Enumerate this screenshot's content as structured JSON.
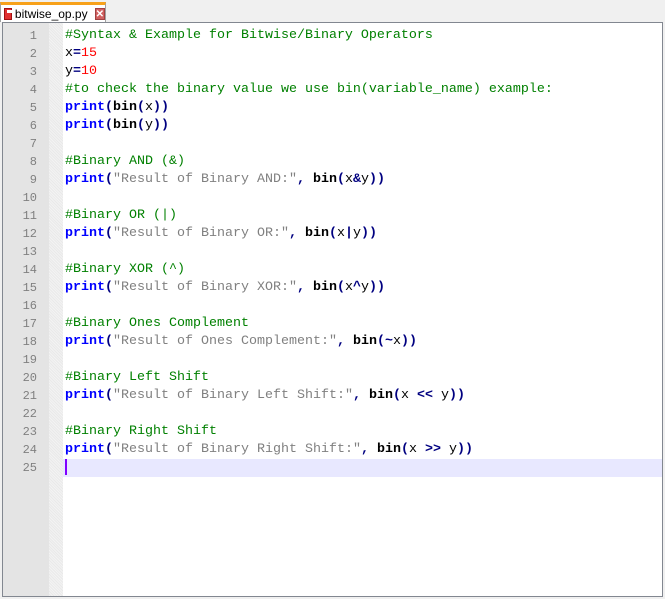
{
  "tab": {
    "filename": "bitwise_op.py",
    "close_symbol": "✕"
  },
  "current_line": 25,
  "lines": [
    [
      [
        "c",
        "#Syntax & Example for Bitwise/Binary Operators"
      ]
    ],
    [
      [
        "i",
        "x"
      ],
      [
        "o",
        "="
      ],
      [
        "n",
        "15"
      ]
    ],
    [
      [
        "i",
        "y"
      ],
      [
        "o",
        "="
      ],
      [
        "n",
        "10"
      ]
    ],
    [
      [
        "c",
        "#to check the binary value we use bin(variable_name) example:"
      ]
    ],
    [
      [
        "k",
        "print"
      ],
      [
        "o",
        "("
      ],
      [
        "b",
        "bin"
      ],
      [
        "o",
        "("
      ],
      [
        "i",
        "x"
      ],
      [
        "o",
        "))"
      ]
    ],
    [
      [
        "k",
        "print"
      ],
      [
        "o",
        "("
      ],
      [
        "b",
        "bin"
      ],
      [
        "o",
        "("
      ],
      [
        "i",
        "y"
      ],
      [
        "o",
        "))"
      ]
    ],
    [],
    [
      [
        "c",
        "#Binary AND (&)"
      ]
    ],
    [
      [
        "k",
        "print"
      ],
      [
        "o",
        "("
      ],
      [
        "s",
        "\"Result of Binary AND:\""
      ],
      [
        "o",
        ","
      ],
      [
        "i",
        " "
      ],
      [
        "b",
        "bin"
      ],
      [
        "o",
        "("
      ],
      [
        "i",
        "x"
      ],
      [
        "o",
        "&"
      ],
      [
        "i",
        "y"
      ],
      [
        "o",
        "))"
      ]
    ],
    [],
    [
      [
        "c",
        "#Binary OR (|)"
      ]
    ],
    [
      [
        "k",
        "print"
      ],
      [
        "o",
        "("
      ],
      [
        "s",
        "\"Result of Binary OR:\""
      ],
      [
        "o",
        ","
      ],
      [
        "i",
        " "
      ],
      [
        "b",
        "bin"
      ],
      [
        "o",
        "("
      ],
      [
        "i",
        "x"
      ],
      [
        "o",
        "|"
      ],
      [
        "i",
        "y"
      ],
      [
        "o",
        "))"
      ]
    ],
    [],
    [
      [
        "c",
        "#Binary XOR (^)"
      ]
    ],
    [
      [
        "k",
        "print"
      ],
      [
        "o",
        "("
      ],
      [
        "s",
        "\"Result of Binary XOR:\""
      ],
      [
        "o",
        ","
      ],
      [
        "i",
        " "
      ],
      [
        "b",
        "bin"
      ],
      [
        "o",
        "("
      ],
      [
        "i",
        "x"
      ],
      [
        "o",
        "^"
      ],
      [
        "i",
        "y"
      ],
      [
        "o",
        "))"
      ]
    ],
    [],
    [
      [
        "c",
        "#Binary Ones Complement"
      ]
    ],
    [
      [
        "k",
        "print"
      ],
      [
        "o",
        "("
      ],
      [
        "s",
        "\"Result of Ones Complement:\""
      ],
      [
        "o",
        ","
      ],
      [
        "i",
        " "
      ],
      [
        "b",
        "bin"
      ],
      [
        "o",
        "(~"
      ],
      [
        "i",
        "x"
      ],
      [
        "o",
        "))"
      ]
    ],
    [],
    [
      [
        "c",
        "#Binary Left Shift"
      ]
    ],
    [
      [
        "k",
        "print"
      ],
      [
        "o",
        "("
      ],
      [
        "s",
        "\"Result of Binary Left Shift:\""
      ],
      [
        "o",
        ","
      ],
      [
        "i",
        " "
      ],
      [
        "b",
        "bin"
      ],
      [
        "o",
        "("
      ],
      [
        "i",
        "x "
      ],
      [
        "o",
        "<<"
      ],
      [
        "i",
        " y"
      ],
      [
        "o",
        "))"
      ]
    ],
    [],
    [
      [
        "c",
        "#Binary Right Shift"
      ]
    ],
    [
      [
        "k",
        "print"
      ],
      [
        "o",
        "("
      ],
      [
        "s",
        "\"Result of Binary Right Shift:\""
      ],
      [
        "o",
        ","
      ],
      [
        "i",
        " "
      ],
      [
        "b",
        "bin"
      ],
      [
        "o",
        "("
      ],
      [
        "i",
        "x "
      ],
      [
        "o",
        ">>"
      ],
      [
        "i",
        " y"
      ],
      [
        "o",
        "))"
      ]
    ],
    []
  ]
}
